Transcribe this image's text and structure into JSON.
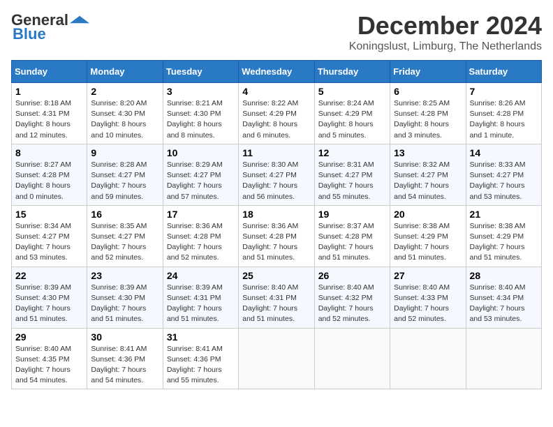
{
  "header": {
    "logo_general": "General",
    "logo_blue": "Blue",
    "month_title": "December 2024",
    "location": "Koningslust, Limburg, The Netherlands"
  },
  "weekdays": [
    "Sunday",
    "Monday",
    "Tuesday",
    "Wednesday",
    "Thursday",
    "Friday",
    "Saturday"
  ],
  "weeks": [
    [
      {
        "day": "1",
        "sunrise": "8:18 AM",
        "sunset": "4:31 PM",
        "daylight": "8 hours and 12 minutes."
      },
      {
        "day": "2",
        "sunrise": "8:20 AM",
        "sunset": "4:30 PM",
        "daylight": "8 hours and 10 minutes."
      },
      {
        "day": "3",
        "sunrise": "8:21 AM",
        "sunset": "4:30 PM",
        "daylight": "8 hours and 8 minutes."
      },
      {
        "day": "4",
        "sunrise": "8:22 AM",
        "sunset": "4:29 PM",
        "daylight": "8 hours and 6 minutes."
      },
      {
        "day": "5",
        "sunrise": "8:24 AM",
        "sunset": "4:29 PM",
        "daylight": "8 hours and 5 minutes."
      },
      {
        "day": "6",
        "sunrise": "8:25 AM",
        "sunset": "4:28 PM",
        "daylight": "8 hours and 3 minutes."
      },
      {
        "day": "7",
        "sunrise": "8:26 AM",
        "sunset": "4:28 PM",
        "daylight": "8 hours and 1 minute."
      }
    ],
    [
      {
        "day": "8",
        "sunrise": "8:27 AM",
        "sunset": "4:28 PM",
        "daylight": "8 hours and 0 minutes."
      },
      {
        "day": "9",
        "sunrise": "8:28 AM",
        "sunset": "4:27 PM",
        "daylight": "7 hours and 59 minutes."
      },
      {
        "day": "10",
        "sunrise": "8:29 AM",
        "sunset": "4:27 PM",
        "daylight": "7 hours and 57 minutes."
      },
      {
        "day": "11",
        "sunrise": "8:30 AM",
        "sunset": "4:27 PM",
        "daylight": "7 hours and 56 minutes."
      },
      {
        "day": "12",
        "sunrise": "8:31 AM",
        "sunset": "4:27 PM",
        "daylight": "7 hours and 55 minutes."
      },
      {
        "day": "13",
        "sunrise": "8:32 AM",
        "sunset": "4:27 PM",
        "daylight": "7 hours and 54 minutes."
      },
      {
        "day": "14",
        "sunrise": "8:33 AM",
        "sunset": "4:27 PM",
        "daylight": "7 hours and 53 minutes."
      }
    ],
    [
      {
        "day": "15",
        "sunrise": "8:34 AM",
        "sunset": "4:27 PM",
        "daylight": "7 hours and 53 minutes."
      },
      {
        "day": "16",
        "sunrise": "8:35 AM",
        "sunset": "4:27 PM",
        "daylight": "7 hours and 52 minutes."
      },
      {
        "day": "17",
        "sunrise": "8:36 AM",
        "sunset": "4:28 PM",
        "daylight": "7 hours and 52 minutes."
      },
      {
        "day": "18",
        "sunrise": "8:36 AM",
        "sunset": "4:28 PM",
        "daylight": "7 hours and 51 minutes."
      },
      {
        "day": "19",
        "sunrise": "8:37 AM",
        "sunset": "4:28 PM",
        "daylight": "7 hours and 51 minutes."
      },
      {
        "day": "20",
        "sunrise": "8:38 AM",
        "sunset": "4:29 PM",
        "daylight": "7 hours and 51 minutes."
      },
      {
        "day": "21",
        "sunrise": "8:38 AM",
        "sunset": "4:29 PM",
        "daylight": "7 hours and 51 minutes."
      }
    ],
    [
      {
        "day": "22",
        "sunrise": "8:39 AM",
        "sunset": "4:30 PM",
        "daylight": "7 hours and 51 minutes."
      },
      {
        "day": "23",
        "sunrise": "8:39 AM",
        "sunset": "4:30 PM",
        "daylight": "7 hours and 51 minutes."
      },
      {
        "day": "24",
        "sunrise": "8:39 AM",
        "sunset": "4:31 PM",
        "daylight": "7 hours and 51 minutes."
      },
      {
        "day": "25",
        "sunrise": "8:40 AM",
        "sunset": "4:31 PM",
        "daylight": "7 hours and 51 minutes."
      },
      {
        "day": "26",
        "sunrise": "8:40 AM",
        "sunset": "4:32 PM",
        "daylight": "7 hours and 52 minutes."
      },
      {
        "day": "27",
        "sunrise": "8:40 AM",
        "sunset": "4:33 PM",
        "daylight": "7 hours and 52 minutes."
      },
      {
        "day": "28",
        "sunrise": "8:40 AM",
        "sunset": "4:34 PM",
        "daylight": "7 hours and 53 minutes."
      }
    ],
    [
      {
        "day": "29",
        "sunrise": "8:40 AM",
        "sunset": "4:35 PM",
        "daylight": "7 hours and 54 minutes."
      },
      {
        "day": "30",
        "sunrise": "8:41 AM",
        "sunset": "4:36 PM",
        "daylight": "7 hours and 54 minutes."
      },
      {
        "day": "31",
        "sunrise": "8:41 AM",
        "sunset": "4:36 PM",
        "daylight": "7 hours and 55 minutes."
      },
      null,
      null,
      null,
      null
    ]
  ]
}
